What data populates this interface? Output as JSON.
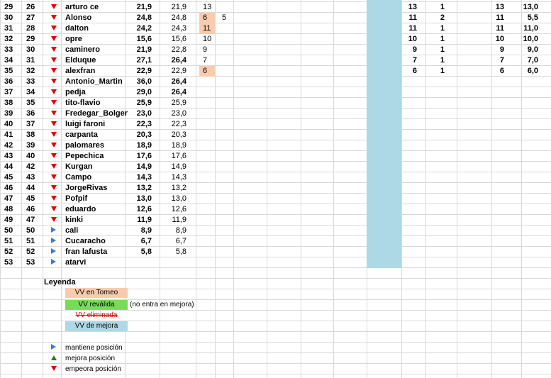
{
  "rows": [
    {
      "n1": "29",
      "n2": "26",
      "arrow": "down",
      "name": "arturo ce",
      "v1": "21,9",
      "v2": "21,9",
      "v2bold": false,
      "v3": "13",
      "v3peach": false,
      "v4": "",
      "r1": "13",
      "r2": "1",
      "r3": "13",
      "r4": "13,0"
    },
    {
      "n1": "30",
      "n2": "27",
      "arrow": "down",
      "name": "Alonso",
      "v1": "24,8",
      "v2": "24,8",
      "v2bold": false,
      "v3": "6",
      "v3peach": true,
      "v4": "5",
      "r1": "11",
      "r2": "2",
      "r3": "11",
      "r4": "5,5"
    },
    {
      "n1": "31",
      "n2": "28",
      "arrow": "down",
      "name": "dalton",
      "v1": "24,2",
      "v2": "24,3",
      "v2bold": false,
      "v3": "11",
      "v3peach": true,
      "v4": "",
      "r1": "11",
      "r2": "1",
      "r3": "11",
      "r4": "11,0"
    },
    {
      "n1": "32",
      "n2": "29",
      "arrow": "down",
      "name": "opre",
      "v1": "15,6",
      "v2": "15,6",
      "v2bold": false,
      "v3": "10",
      "v3peach": false,
      "v4": "",
      "r1": "10",
      "r2": "1",
      "r3": "10",
      "r4": "10,0"
    },
    {
      "n1": "33",
      "n2": "30",
      "arrow": "down",
      "name": "caminero",
      "v1": "21,9",
      "v2": "22,8",
      "v2bold": false,
      "v3": "9",
      "v3peach": false,
      "v4": "",
      "r1": "9",
      "r2": "1",
      "r3": "9",
      "r4": "9,0"
    },
    {
      "n1": "34",
      "n2": "31",
      "arrow": "down",
      "name": "Elduque",
      "v1": "27,1",
      "v2": "26,4",
      "v2bold": true,
      "v3": "7",
      "v3peach": false,
      "v4": "",
      "r1": "7",
      "r2": "1",
      "r3": "7",
      "r4": "7,0"
    },
    {
      "n1": "35",
      "n2": "32",
      "arrow": "down",
      "name": "alexfran",
      "v1": "22,9",
      "v2": "22,9",
      "v2bold": false,
      "v3": "6",
      "v3peach": true,
      "v4": "",
      "r1": "6",
      "r2": "1",
      "r3": "6",
      "r4": "6,0"
    },
    {
      "n1": "36",
      "n2": "33",
      "arrow": "down",
      "name": "Antonio_Martin",
      "v1": "36,0",
      "v2": "26,4",
      "v2bold": true,
      "v3": "",
      "v3peach": false,
      "v4": "",
      "r1": "",
      "r2": "",
      "r3": "",
      "r4": ""
    },
    {
      "n1": "37",
      "n2": "34",
      "arrow": "down",
      "name": "pedja",
      "v1": "29,0",
      "v2": "26,4",
      "v2bold": true,
      "v3": "",
      "v3peach": false,
      "v4": "",
      "r1": "",
      "r2": "",
      "r3": "",
      "r4": ""
    },
    {
      "n1": "38",
      "n2": "35",
      "arrow": "down",
      "name": "tito-flavio",
      "v1": "25,9",
      "v2": "25,9",
      "v2bold": false,
      "v3": "",
      "v3peach": false,
      "v4": "",
      "r1": "",
      "r2": "",
      "r3": "",
      "r4": ""
    },
    {
      "n1": "39",
      "n2": "36",
      "arrow": "down",
      "name": "Fredegar_Bolger",
      "v1": "23,0",
      "v2": "23,0",
      "v2bold": false,
      "v3": "",
      "v3peach": false,
      "v4": "",
      "r1": "",
      "r2": "",
      "r3": "",
      "r4": ""
    },
    {
      "n1": "40",
      "n2": "37",
      "arrow": "down",
      "name": "luigi faroni",
      "v1": "22,3",
      "v2": "22,3",
      "v2bold": false,
      "v3": "",
      "v3peach": false,
      "v4": "",
      "r1": "",
      "r2": "",
      "r3": "",
      "r4": ""
    },
    {
      "n1": "41",
      "n2": "38",
      "arrow": "down",
      "name": "carpanta",
      "v1": "20,3",
      "v2": "20,3",
      "v2bold": false,
      "v3": "",
      "v3peach": false,
      "v4": "",
      "r1": "",
      "r2": "",
      "r3": "",
      "r4": ""
    },
    {
      "n1": "42",
      "n2": "39",
      "arrow": "down",
      "name": "palomares",
      "v1": "18,9",
      "v2": "18,9",
      "v2bold": false,
      "v3": "",
      "v3peach": false,
      "v4": "",
      "r1": "",
      "r2": "",
      "r3": "",
      "r4": ""
    },
    {
      "n1": "43",
      "n2": "40",
      "arrow": "down",
      "name": "Pepechica",
      "v1": "17,6",
      "v2": "17,6",
      "v2bold": false,
      "v3": "",
      "v3peach": false,
      "v4": "",
      "r1": "",
      "r2": "",
      "r3": "",
      "r4": ""
    },
    {
      "n1": "44",
      "n2": "42",
      "arrow": "down",
      "name": "Kurgan",
      "v1": "14,9",
      "v2": "14,9",
      "v2bold": false,
      "v3": "",
      "v3peach": false,
      "v4": "",
      "r1": "",
      "r2": "",
      "r3": "",
      "r4": ""
    },
    {
      "n1": "45",
      "n2": "43",
      "arrow": "down",
      "name": "Campo",
      "v1": "14,3",
      "v2": "14,3",
      "v2bold": false,
      "v3": "",
      "v3peach": false,
      "v4": "",
      "r1": "",
      "r2": "",
      "r3": "",
      "r4": ""
    },
    {
      "n1": "46",
      "n2": "44",
      "arrow": "down",
      "name": "JorgeRivas",
      "v1": "13,2",
      "v2": "13,2",
      "v2bold": false,
      "v3": "",
      "v3peach": false,
      "v4": "",
      "r1": "",
      "r2": "",
      "r3": "",
      "r4": ""
    },
    {
      "n1": "47",
      "n2": "45",
      "arrow": "down",
      "name": "Pofpif",
      "v1": "13,0",
      "v2": "13,0",
      "v2bold": false,
      "v3": "",
      "v3peach": false,
      "v4": "",
      "r1": "",
      "r2": "",
      "r3": "",
      "r4": ""
    },
    {
      "n1": "48",
      "n2": "46",
      "arrow": "down",
      "name": "eduardo",
      "v1": "12,6",
      "v2": "12,6",
      "v2bold": false,
      "v3": "",
      "v3peach": false,
      "v4": "",
      "r1": "",
      "r2": "",
      "r3": "",
      "r4": ""
    },
    {
      "n1": "49",
      "n2": "47",
      "arrow": "down",
      "name": "kinki",
      "v1": "11,9",
      "v2": "11,9",
      "v2bold": false,
      "v3": "",
      "v3peach": false,
      "v4": "",
      "r1": "",
      "r2": "",
      "r3": "",
      "r4": ""
    },
    {
      "n1": "50",
      "n2": "50",
      "arrow": "right",
      "name": "cali",
      "v1": "8,9",
      "v2": "8,9",
      "v2bold": false,
      "v3": "",
      "v3peach": false,
      "v4": "",
      "r1": "",
      "r2": "",
      "r3": "",
      "r4": ""
    },
    {
      "n1": "51",
      "n2": "51",
      "arrow": "right",
      "name": "Cucaracho",
      "v1": "6,7",
      "v2": "6,7",
      "v2bold": false,
      "v3": "",
      "v3peach": false,
      "v4": "",
      "r1": "",
      "r2": "",
      "r3": "",
      "r4": ""
    },
    {
      "n1": "52",
      "n2": "52",
      "arrow": "right",
      "name": "fran lafusta",
      "v1": "5,8",
      "v2": "5,8",
      "v2bold": false,
      "v3": "",
      "v3peach": false,
      "v4": "",
      "r1": "",
      "r2": "",
      "r3": "",
      "r4": ""
    },
    {
      "n1": "53",
      "n2": "53",
      "arrow": "right",
      "name": "atarvi",
      "v1": "",
      "v2": "",
      "v2bold": false,
      "v3": "",
      "v3peach": false,
      "v4": "",
      "r1": "",
      "r2": "",
      "r3": "",
      "r4": ""
    }
  ],
  "legend": {
    "title": "Leyenda",
    "torneo": "VV en Torneo",
    "revalida": "VV reválida",
    "revalida_note": "(no entra en mejora)",
    "eliminada": "VV eliminada",
    "mejora": "VV de mejora",
    "mantiene": "mantiene posición",
    "mejora_pos": "mejora posición",
    "empeora": "empeora posición"
  },
  "colors": {
    "peach": "#f8cbad",
    "green": "#7ed957",
    "light_blue": "#add8e6",
    "red_arrow": "#e00000",
    "blue_arrow": "#3c78d8",
    "green_arrow": "#38761d"
  }
}
